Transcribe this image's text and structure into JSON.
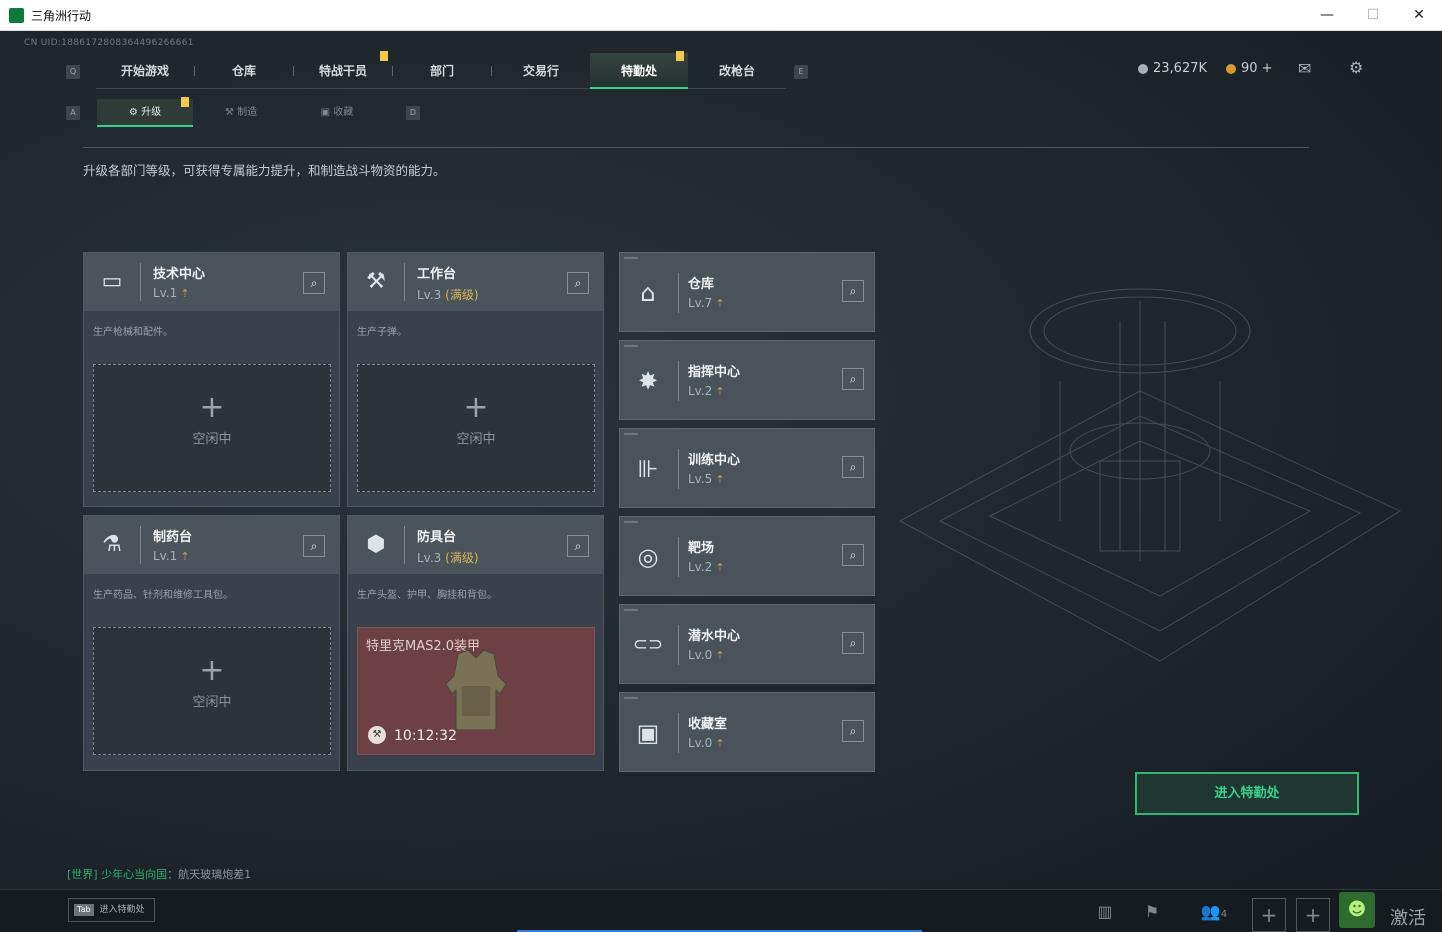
{
  "window": {
    "title": "三角洲行动",
    "minimize": "—",
    "maximize": "☐",
    "close": "✕"
  },
  "uid": "CN UID:1886172808364496266661",
  "top_nav": {
    "left_key": "Q",
    "right_key": "E",
    "tabs": [
      {
        "label": "开始游戏"
      },
      {
        "label": "仓库"
      },
      {
        "label": "特战干员"
      },
      {
        "label": "部门"
      },
      {
        "label": "交易行"
      },
      {
        "label": "特勤处"
      },
      {
        "label": "改枪台"
      }
    ]
  },
  "currency": {
    "coins": "23,627K",
    "premium": "90 +"
  },
  "sub_nav": {
    "left_key": "A",
    "right_key": "D",
    "tabs": [
      {
        "label": "升级"
      },
      {
        "label": "制造"
      },
      {
        "label": "收藏"
      }
    ]
  },
  "description": "升级各部门等级，可获得专属能力提升，和制造战斗物资的能力。",
  "idle_label": "空闲中",
  "plus_symbol": "+",
  "magnifier": "⌕",
  "level_up_glyph": "⇡",
  "workshops": [
    {
      "name": "技术中心",
      "level": "Lv.1",
      "max": "",
      "desc": "生产枪械和配件。",
      "icon": "computer-icon",
      "glyph": "▭"
    },
    {
      "name": "工作台",
      "level": "Lv.3",
      "max": "(满级)",
      "desc": "生产子弹。",
      "icon": "tools-icon",
      "glyph": "⚒"
    },
    {
      "name": "制药台",
      "level": "Lv.1",
      "max": "",
      "desc": "生产药品、针剂和维修工具包。",
      "icon": "microscope-icon",
      "glyph": "⚗"
    },
    {
      "name": "防具台",
      "level": "Lv.3",
      "max": "(满级)",
      "desc": "生产头盔、护甲、胸挂和背包。",
      "icon": "armor-parts-icon",
      "glyph": "⬢"
    }
  ],
  "crafting": {
    "item": "特里克MAS2.0装甲",
    "timer": "10:12:32"
  },
  "facilities": [
    {
      "name": "仓库",
      "level": "Lv.7",
      "icon": "storage-icon",
      "glyph": "⌂"
    },
    {
      "name": "指挥中心",
      "level": "Lv.2",
      "icon": "command-icon",
      "glyph": "✸"
    },
    {
      "name": "训练中心",
      "level": "Lv.5",
      "icon": "dumbbell-icon",
      "glyph": "⊪"
    },
    {
      "name": "靶场",
      "level": "Lv.2",
      "icon": "target-icon",
      "glyph": "◎"
    },
    {
      "name": "潜水中心",
      "level": "Lv.0",
      "icon": "diving-mask-icon",
      "glyph": "⊂⊃"
    },
    {
      "name": "收藏室",
      "level": "Lv.0",
      "icon": "collection-icon",
      "glyph": "▣"
    }
  ],
  "enter_button": "进入特勤处",
  "chat": {
    "channel": "[世界] 少年心当向国",
    "message": "：航天玻璃炮差1"
  },
  "bottom": {
    "tab_key": "Tab",
    "tab_label": "进入特勤处",
    "friends_count": "4",
    "activate": "激活"
  },
  "colors": {
    "accent": "#3ad18d",
    "max_level": "#d6b55a",
    "badge": "#f2c94c",
    "craft_bg": "#6c4044"
  }
}
